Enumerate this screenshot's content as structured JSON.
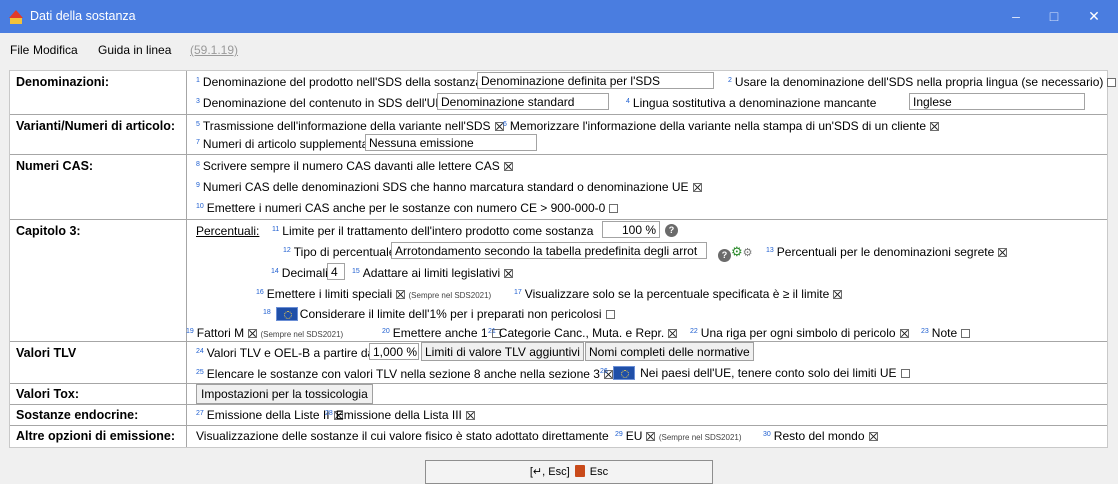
{
  "window": {
    "title": "Dati della sostanza",
    "minimize": "–",
    "maximize": "□",
    "close": "✕"
  },
  "menu": {
    "file": "File",
    "modifica": "Modifica",
    "guida": "Guida in linea",
    "version": "(59.1.19)"
  },
  "denominazioni": {
    "label": "Denominazioni:",
    "n1": "1",
    "l1": "Denominazione del prodotto nell'SDS della sostanza",
    "v1": "Denominazione definita per l'SDS",
    "n2": "2",
    "l2": "Usare la denominazione dell'SDS nella propria lingua (se necessario)",
    "c2": false,
    "n3": "3",
    "l3": "Denominazione del contenuto in SDS dell'UE",
    "v3": "Denominazione standard",
    "n4": "4",
    "l4": "Lingua sostitutiva a denominazione mancante",
    "v4": "Inglese"
  },
  "varianti": {
    "label": "Varianti/Numeri di articolo:",
    "n5": "5",
    "l5": "Trasmissione dell'informazione della variante nell'SDS",
    "c5": true,
    "n6": "6",
    "l6": "Memorizzare l'informazione della variante nella stampa di un'SDS di un cliente",
    "c6": true,
    "n7": "7",
    "l7": "Numeri di articolo supplementare",
    "v7": "Nessuna emissione"
  },
  "cas": {
    "label": "Numeri CAS:",
    "n8": "8",
    "l8": "Scrivere sempre il numero CAS davanti alle lettere CAS",
    "c8": true,
    "n9": "9",
    "l9": "Numeri CAS delle denominazioni SDS che hanno marcatura standard o denominazione UE",
    "c9": true,
    "n10": "10",
    "l10": "Emettere i numeri CAS anche per le sostanze con numero CE > 900-000-0",
    "c10": false
  },
  "capitolo": {
    "label": "Capitolo 3:",
    "percentuali": "Percentuali:",
    "n11": "11",
    "l11": "Limite per il trattamento dell'intero prodotto come sostanza",
    "v11": "100 %",
    "n12": "12",
    "l12": "Tipo di percentuale",
    "v12": "Arrotondamento secondo la tabella predefinita degli arrot",
    "n13": "13",
    "l13": "Percentuali per le denominazioni segrete",
    "c13": true,
    "n14": "14",
    "l14": "Decimali",
    "v14": "4",
    "n15": "15",
    "l15": "Adattare ai limiti legislativi",
    "c15": true,
    "n16": "16",
    "l16": "Emettere i limiti speciali",
    "c16": true,
    "s16": "(Sempre nel SDS2021)",
    "n17": "17",
    "l17": "Visualizzare solo se la percentuale specificata è ≥ il limite",
    "c17": true,
    "n18": "18",
    "l18": "Considerare il limite dell'1% per i preparati non pericolosi",
    "c18": false,
    "n19": "19",
    "l19": "Fattori M",
    "c19": true,
    "s19": "(Sempre nel SDS2021)",
    "n20": "20",
    "l20": "Emettere anche 1",
    "c20": false,
    "n21": "21",
    "l21": "Categorie Canc., Muta. e Repr.",
    "c21": true,
    "n22": "22",
    "l22": "Una riga per ogni simbolo di pericolo",
    "c22": true,
    "n23": "23",
    "l23": "Note",
    "c23": false
  },
  "tlv": {
    "label": "Valori TLV",
    "n24": "24",
    "l24": "Valori TLV e OEL-B a partire da",
    "v24": "1,000 %",
    "b24a": "Limiti di valore TLV aggiuntivi",
    "b24b": "Nomi completi delle normative",
    "n25": "25",
    "l25": "Elencare le sostanze con valori TLV nella sezione 8 anche nella sezione 3",
    "c25": true,
    "n26": "26",
    "l26": "Nei paesi dell'UE, tenere conto solo dei limiti UE",
    "c26": false
  },
  "tox": {
    "label": "Valori Tox:",
    "button": "Impostazioni per la tossicologia"
  },
  "endo": {
    "label": "Sostanze endocrine:",
    "n27": "27",
    "l27": "Emissione della Liste II",
    "c27": true,
    "n28": "28",
    "l28": "Emissione della Lista III",
    "c28": true
  },
  "altre": {
    "label": "Altre opzioni di emissione:",
    "l_intro": "Visualizzazione delle sostanze il cui valore fisico è stato adottato direttamente",
    "n29": "29",
    "l29": "EU",
    "c29": true,
    "s29": "(Sempre nel SDS2021)",
    "n30": "30",
    "l30": "Resto del mondo",
    "c30": true
  },
  "footer": {
    "shortcut": "[↵, Esc]",
    "esc": "Esc"
  }
}
